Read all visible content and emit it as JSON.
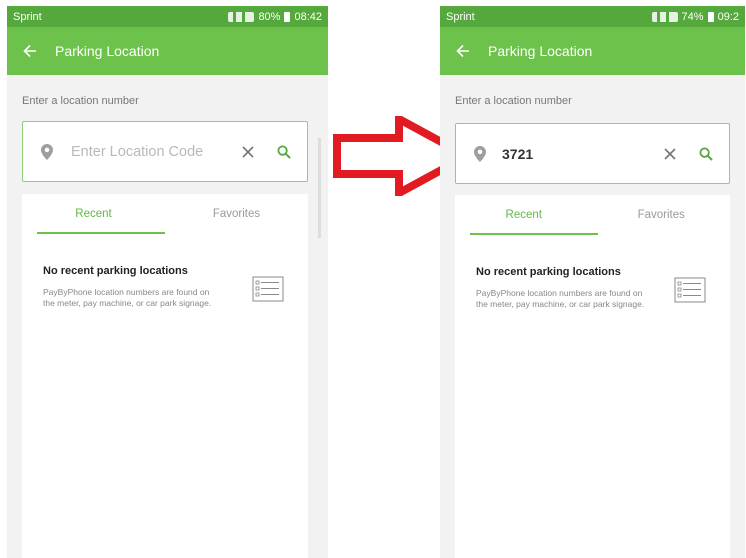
{
  "left_screen": {
    "status": {
      "carrier": "Sprint",
      "battery": "80%",
      "time": "08:42"
    },
    "app_bar": {
      "title": "Parking Location"
    },
    "section_label": "Enter a location number",
    "search": {
      "placeholder": "Enter Location Code",
      "value": ""
    },
    "tabs": [
      {
        "label": "Recent",
        "active": true
      },
      {
        "label": "Favorites",
        "active": false
      }
    ],
    "empty_state": {
      "title": "No recent parking locations",
      "description": "PayByPhone location numbers are found on the meter, pay machine, or car park signage."
    }
  },
  "right_screen": {
    "status": {
      "carrier": "Sprint",
      "battery": "74%",
      "time": "09:2"
    },
    "app_bar": {
      "title": "Parking Location"
    },
    "section_label": "Enter a location number",
    "search": {
      "placeholder": "Enter Location Code",
      "value": "3721"
    },
    "tabs": [
      {
        "label": "Recent",
        "active": true
      },
      {
        "label": "Favorites",
        "active": false
      }
    ],
    "empty_state": {
      "title": "No recent parking locations",
      "description": "PayByPhone location numbers are found on the meter, pay machine, or car park signage."
    }
  },
  "colors": {
    "status_bar": "#55a83c",
    "app_bar": "#6cc24a",
    "accent": "#6cc24a",
    "arrow": "#e21b23"
  },
  "icons": [
    "back-arrow-icon",
    "map-pin-icon",
    "clear-icon",
    "search-icon",
    "list-document-icon",
    "right-arrow-icon"
  ]
}
